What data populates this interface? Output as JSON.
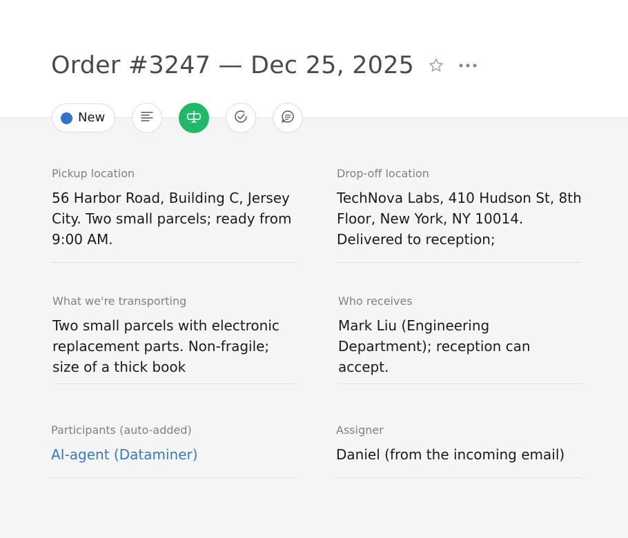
{
  "header": {
    "title": "Order #3247 — Dec 25, 2025"
  },
  "icons": {
    "favorite": "star-outline-icon",
    "more": "more-horizontal-icon",
    "details": "list-lines-icon",
    "transport": "transit-sign-icon",
    "complete": "check-circle-icon",
    "comments": "comment-icon"
  },
  "colors": {
    "status_new": "#2f73c9",
    "active_tool": "#21b86a",
    "link": "#3a79bf"
  },
  "toolbar": {
    "status_label": "New"
  },
  "fields": {
    "pickup": {
      "label": "Pickup location",
      "value": "56 Harbor Road, Building C, Jersey City. Two small parcels; ready from 9:00 AM."
    },
    "dropoff": {
      "label": "Drop-off location",
      "value": "TechNova Labs, 410 Hudson St, 8th Floor, New York, NY 10014. Delivered to reception;"
    },
    "transporting": {
      "label": "What we're transporting",
      "value": "Two small parcels with electronic replacement parts. Non-fragile; size of a thick book"
    },
    "receiver": {
      "label": "Who receives",
      "value": "Mark Liu (Engineering Department); reception can accept."
    },
    "participants": {
      "label": "Participants (auto-added)",
      "value": "AI-agent (Dataminer)"
    },
    "assigner": {
      "label": "Assigner",
      "value": "Daniel (from the incoming email)"
    }
  }
}
